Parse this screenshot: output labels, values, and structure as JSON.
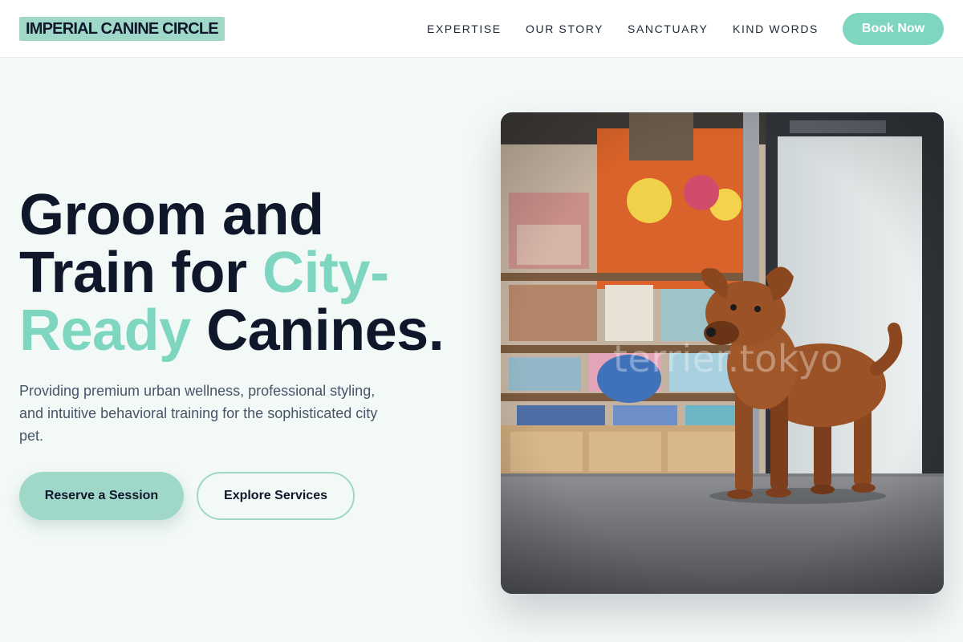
{
  "brand": {
    "logo": "IMPERIAL CANINE CIRCLE"
  },
  "nav": {
    "links": [
      "EXPERTISE",
      "OUR STORY",
      "SANCTUARY",
      "KIND WORDS"
    ],
    "cta": "Book Now"
  },
  "hero": {
    "headline_line1": "Groom and",
    "headline_line2a": "Train for ",
    "headline_line2b": "City-",
    "headline_line3a": "Ready",
    "headline_line3b": " Canines.",
    "subtext": "Providing premium urban wellness, professional styling, and intuitive behavioral training for the sophisticated city pet.",
    "primary_button": "Reserve a Session",
    "secondary_button": "Explore Services",
    "image_watermark": "terrier.tokyo"
  },
  "colors": {
    "accent": "#7fd6c0",
    "logo_bg": "#9fd8c9",
    "heading": "#0f172a",
    "page_bg": "#f3f9f7"
  }
}
